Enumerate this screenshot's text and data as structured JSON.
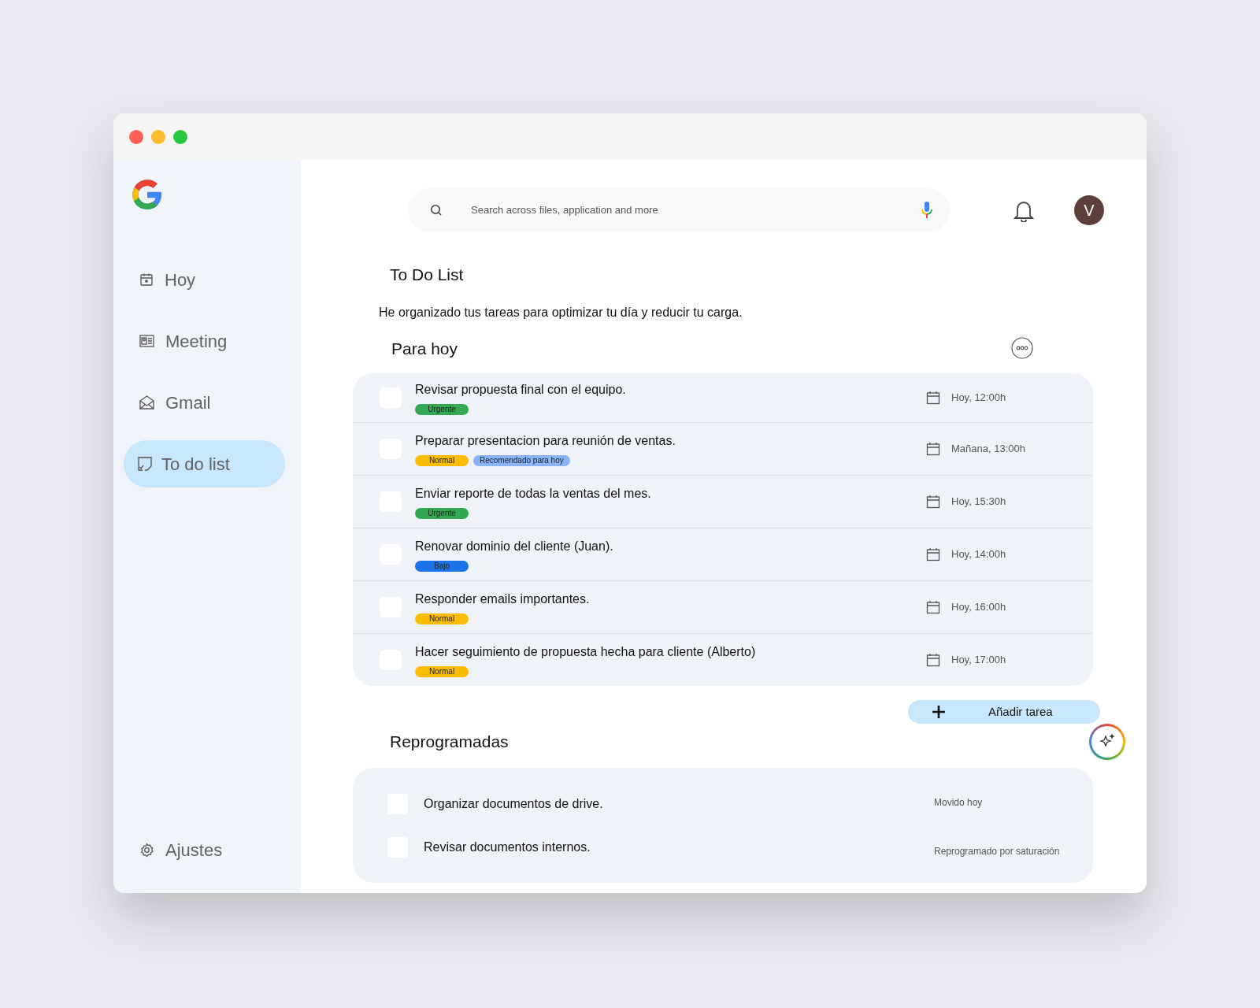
{
  "sidebar": {
    "items": [
      {
        "label": "Hoy",
        "selected": false
      },
      {
        "label": "Meeting",
        "selected": false
      },
      {
        "label": "Gmail",
        "selected": false
      },
      {
        "label": "To do list",
        "selected": true
      }
    ],
    "footer_item": {
      "label": "Ajustes"
    }
  },
  "search": {
    "placeholder": "Search across files, application and more"
  },
  "avatar": {
    "initial": "V"
  },
  "title": "To Do List",
  "description": "He organizado tus tareas para optimizar tu día y reducir tu carga.",
  "today": {
    "heading": "Para hoy",
    "tasks": [
      {
        "text": "Revisar propuesta final con el equipo.",
        "checked": false,
        "tags": [
          {
            "label": "Urgente",
            "color": "#34a853"
          }
        ],
        "due": "Hoy, 12:00h"
      },
      {
        "text": "Preparar presentacion para reunión de ventas.",
        "checked": false,
        "tags": [
          {
            "label": "Normal",
            "color": "#fbbc04"
          },
          {
            "label": "Recomendado para hoy",
            "color": "#8ab4f8"
          }
        ],
        "due": "Mañana, 13:00h"
      },
      {
        "text": "Enviar reporte de todas la ventas del mes.",
        "checked": false,
        "tags": [
          {
            "label": "Urgente",
            "color": "#34a853"
          }
        ],
        "due": "Hoy, 15:30h"
      },
      {
        "text": "Renovar dominio del cliente (Juan).",
        "checked": false,
        "tags": [
          {
            "label": "Bajo",
            "color": "#1a73e8"
          }
        ],
        "due": "Hoy, 14:00h"
      },
      {
        "text": "Responder emails importantes.",
        "checked": false,
        "tags": [
          {
            "label": "Normal",
            "color": "#fbbc04"
          }
        ],
        "due": "Hoy, 16:00h"
      },
      {
        "text": "Hacer seguimiento de propuesta hecha para cliente (Alberto)",
        "checked": false,
        "tags": [
          {
            "label": "Normal",
            "color": "#fbbc04"
          }
        ],
        "due": "Hoy, 17:00h"
      }
    ]
  },
  "add_button": {
    "label": "Añadir tarea"
  },
  "rescheduled": {
    "heading": "Reprogramadas",
    "tasks": [
      {
        "text": "Organizar documentos de drive.",
        "checked": false,
        "note": "Movido hoy"
      },
      {
        "text": "Revisar documentos internos.",
        "checked": false,
        "note": "Reprogramado por saturación"
      }
    ]
  }
}
